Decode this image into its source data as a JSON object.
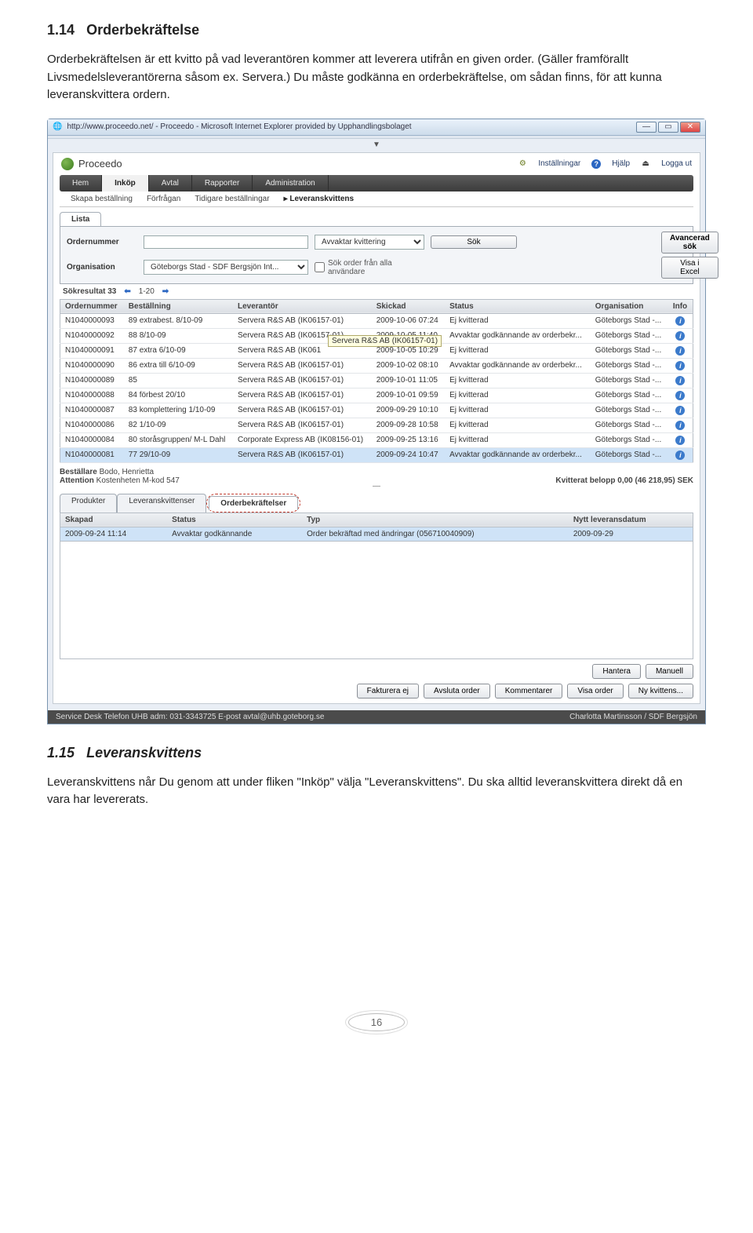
{
  "sections": {
    "s1": {
      "num": "1.14",
      "title": "Orderbekräftelse",
      "body": "Orderbekräftelsen är ett kvitto på vad leverantören kommer att leverera utifrån en given order. (Gäller framförallt Livsmedelsleverantörerna såsom ex. Servera.) Du måste godkänna en orderbekräftelse, om sådan finns, för att kunna leveranskvittera ordern."
    },
    "s2": {
      "num": "1.15",
      "title": "Leveranskvittens",
      "body": "Leveranskvittens når Du genom att under fliken \"Inköp\" välja \"Leveranskvittens\". Du ska alltid leveranskvittera direkt då en vara har levererats."
    }
  },
  "window": {
    "url": "http://www.proceedo.net/ - Proceedo - Microsoft Internet Explorer provided by Upphandlingsbolaget",
    "min": "—",
    "max": "▭",
    "close": "✕"
  },
  "brand": "Proceedo",
  "toplinks": {
    "settings": "Inställningar",
    "help": "Hjälp",
    "logout": "Logga ut"
  },
  "nav": [
    "Hem",
    "Inköp",
    "Avtal",
    "Rapporter",
    "Administration"
  ],
  "nav_active": 1,
  "subnav": [
    "Skapa beställning",
    "Förfrågan",
    "Tidigare beställningar",
    "▸ Leveranskvittens"
  ],
  "lista": "Lista",
  "filters": {
    "ordernummer_lbl": "Ordernummer",
    "ordernummer_val": "",
    "status_lbl": "",
    "status_val": "Avvaktar kvittering",
    "sok": "Sök",
    "organisation_lbl": "Organisation",
    "organisation_val": "Göteborgs Stad - SDF Bergsjön Int...",
    "chk_lbl": "Sök order från alla användare",
    "adv": "Avancerad sök",
    "excel": "Visa i Excel"
  },
  "result": {
    "label": "Sökresultat 33",
    "range": "1-20"
  },
  "grid": {
    "cols": [
      "Ordernummer",
      "Beställning",
      "Leverantör",
      "Skickad",
      "Status",
      "Organisation",
      "Info"
    ],
    "rows": [
      [
        "N1040000093",
        "89 extrabest. 8/10-09",
        "Servera R&S AB (IK06157-01)",
        "2009-10-06 07:24",
        "Ej kvitterad",
        "Göteborgs Stad -..."
      ],
      [
        "N1040000092",
        "88 8/10-09",
        "Servera R&S AB (IK06157-01)",
        "2009-10-05 11:40",
        "Avvaktar godkännande av orderbekr...",
        "Göteborgs Stad -..."
      ],
      [
        "N1040000091",
        "87 extra 6/10-09",
        "Servera R&S AB (IK061",
        "2009-10-05 10:29",
        "Ej kvitterad",
        "Göteborgs Stad -..."
      ],
      [
        "N1040000090",
        "86 extra till 6/10-09",
        "Servera R&S AB (IK06157-01)",
        "2009-10-02 08:10",
        "Avvaktar godkännande av orderbekr...",
        "Göteborgs Stad -..."
      ],
      [
        "N1040000089",
        "85",
        "Servera R&S AB (IK06157-01)",
        "2009-10-01 11:05",
        "Ej kvitterad",
        "Göteborgs Stad -..."
      ],
      [
        "N1040000088",
        "84 förbest 20/10",
        "Servera R&S AB (IK06157-01)",
        "2009-10-01 09:59",
        "Ej kvitterad",
        "Göteborgs Stad -..."
      ],
      [
        "N1040000087",
        "83 komplettering 1/10-09",
        "Servera R&S AB (IK06157-01)",
        "2009-09-29 10:10",
        "Ej kvitterad",
        "Göteborgs Stad -..."
      ],
      [
        "N1040000086",
        "82 1/10-09",
        "Servera R&S AB (IK06157-01)",
        "2009-09-28 10:58",
        "Ej kvitterad",
        "Göteborgs Stad -..."
      ],
      [
        "N1040000084",
        "80 storåsgruppen/ M-L Dahl",
        "Corporate Express AB (IK08156-01)",
        "2009-09-25 13:16",
        "Ej kvitterad",
        "Göteborgs Stad -..."
      ],
      [
        "N1040000081",
        "77 29/10-09",
        "Servera R&S AB (IK06157-01)",
        "2009-09-24 10:47",
        "Avvaktar godkännande av orderbekr...",
        "Göteborgs Stad -..."
      ]
    ],
    "selected": 9
  },
  "tooltip": "Servera R&S AB (IK06157-01)",
  "detail": {
    "bestallare_lbl": "Beställare",
    "bestallare_val": "Bodo, Henrietta",
    "attention_lbl": "Attention",
    "attention_val": "Kostenheten M-kod 547",
    "kvitt_lbl": "Kvitterat belopp 0,00 (46 218,95) SEK"
  },
  "detail_tabs": [
    "Produkter",
    "Leveranskvittenser",
    "Orderbekräftelser"
  ],
  "grid2": {
    "cols": [
      "Skapad",
      "Status",
      "Typ",
      "Nytt leveransdatum"
    ],
    "row": [
      "2009-09-24 11:14",
      "Avvaktar godkännande",
      "Order bekräftad med ändringar (056710040909)",
      "2009-09-29"
    ]
  },
  "btns1": [
    "Hantera",
    "Manuell"
  ],
  "btns2": [
    "Fakturera ej",
    "Avsluta order",
    "Kommentarer",
    "Visa order",
    "Ny kvittens..."
  ],
  "status": {
    "left": "Service Desk Telefon UHB adm: 031-3343725   E-post avtal@uhb.goteborg.se",
    "right": "Charlotta Martinsson / SDF Bergsjön"
  },
  "pagenum": "16"
}
